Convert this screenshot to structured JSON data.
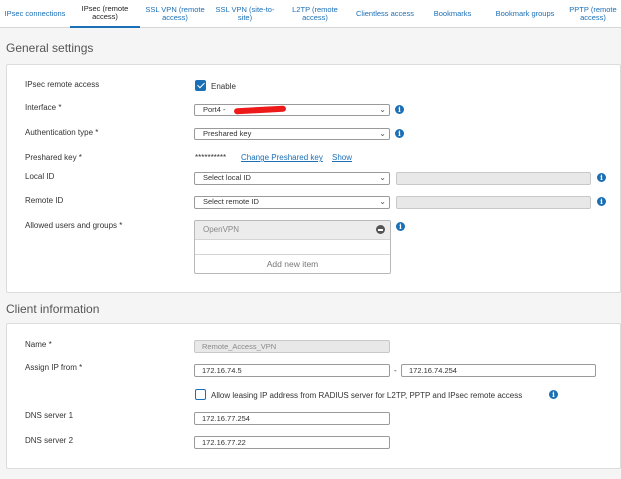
{
  "tabs": [
    {
      "label": "IPsec connections",
      "active": false
    },
    {
      "label": "IPsec (remote access)",
      "active": true
    },
    {
      "label": "SSL VPN (remote access)",
      "active": false
    },
    {
      "label": "SSL VPN (site-to-site)",
      "active": false
    },
    {
      "label": "L2TP (remote access)",
      "active": false
    },
    {
      "label": "Clientless access",
      "active": false
    },
    {
      "label": "Bookmarks",
      "active": false
    },
    {
      "label": "Bookmark groups",
      "active": false
    },
    {
      "label": "PPTP (remote access)",
      "active": false
    }
  ],
  "general": {
    "title": "General settings",
    "ipsec_label": "IPsec remote access",
    "enable_label": "Enable",
    "enable_checked": true,
    "interface_label": "Interface *",
    "interface_value": "Port4 -",
    "auth_label": "Authentication type *",
    "auth_value": "Preshared key",
    "psk_label": "Preshared key *",
    "psk_mask": "**********",
    "psk_change": "Change Preshared key",
    "psk_show": "Show",
    "local_id_label": "Local ID",
    "local_id_value": "Select local ID",
    "remote_id_label": "Remote ID",
    "remote_id_value": "Select remote ID",
    "allowed_label": "Allowed users and groups *",
    "allowed_items": [
      "OpenVPN"
    ],
    "add_new_item": "Add new item"
  },
  "client": {
    "title": "Client information",
    "name_label": "Name *",
    "name_value": "Remote_Access_VPN",
    "assign_label": "Assign IP from *",
    "ip_from": "172.16.74.5",
    "ip_sep": "-",
    "ip_to": "172.16.74.254",
    "radius_label": "Allow leasing IP address from RADIUS server for L2TP, PPTP and IPsec remote access",
    "radius_checked": false,
    "dns1_label": "DNS server 1",
    "dns1_value": "172.16.77.254",
    "dns2_label": "DNS server 2",
    "dns2_value": "172.16.77.22"
  },
  "colors": {
    "accent": "#1a6fb5",
    "redaction": "#ee1a1a"
  },
  "icons": {
    "info": "info-icon",
    "chevron": "chevron-down-icon",
    "remove": "remove-circle-icon",
    "check": "checkmark-icon"
  }
}
